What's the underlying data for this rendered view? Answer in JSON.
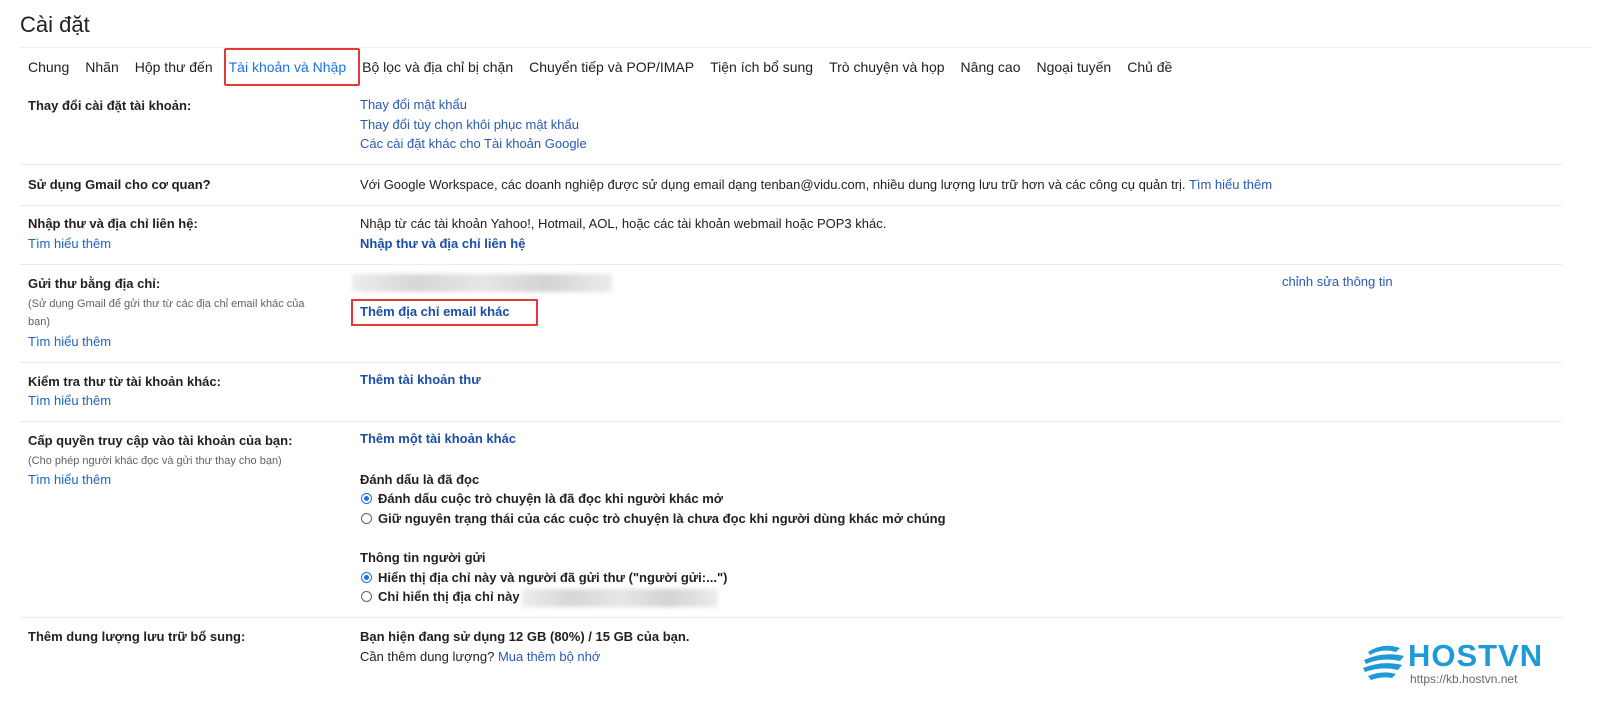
{
  "page_title": "Cài đặt",
  "tabs": [
    {
      "label": "Chung"
    },
    {
      "label": "Nhãn"
    },
    {
      "label": "Hộp thư đến"
    },
    {
      "label": "Tài khoản và Nhập",
      "active": true
    },
    {
      "label": "Bộ lọc và địa chỉ bị chặn"
    },
    {
      "label": "Chuyển tiếp và POP/IMAP"
    },
    {
      "label": "Tiện ích bổ sung"
    },
    {
      "label": "Trò chuyện và họp"
    },
    {
      "label": "Nâng cao"
    },
    {
      "label": "Ngoại tuyến"
    },
    {
      "label": "Chủ đề"
    }
  ],
  "rows": {
    "change_account": {
      "label": "Thay đổi cài đặt tài khoản:",
      "links": [
        "Thay đổi mật khẩu",
        "Thay đổi tùy chọn khôi phục mật khẩu",
        "Các cài đặt khác cho Tài khoản Google"
      ]
    },
    "workspace": {
      "label": "Sử dụng Gmail cho cơ quan?",
      "text": "Với Google Workspace, các doanh nghiệp được sử dụng email dạng tenban@vidu.com, nhiều dung lượng lưu trữ hơn và các công cụ quản trị.",
      "link": "Tìm hiểu thêm"
    },
    "import": {
      "label": "Nhập thư và địa chỉ liên hệ:",
      "learn_more": "Tìm hiểu thêm",
      "text": "Nhập từ các tài khoản Yahoo!, Hotmail, AOL, hoặc các tài khoản webmail hoặc POP3 khác.",
      "action": "Nhập thư và địa chỉ liên hệ"
    },
    "send_as": {
      "label": "Gửi thư bằng địa chỉ:",
      "sub1": "(Sử dụng Gmail để gửi thư từ các địa chỉ email khác của",
      "sub2": "bạn)",
      "learn_more": "Tìm hiểu thêm",
      "edit": "chỉnh sửa thông tin",
      "action": "Thêm địa chỉ email khác"
    },
    "check_mail": {
      "label": "Kiểm tra thư từ tài khoản khác:",
      "learn_more": "Tìm hiểu thêm",
      "action": "Thêm tài khoản thư"
    },
    "grant": {
      "label": "Cấp quyền truy cập vào tài khoản của bạn:",
      "sub": "(Cho phép người khác đọc và gửi thư thay cho bạn)",
      "learn_more": "Tìm hiểu thêm",
      "action": "Thêm một tài khoản khác",
      "mark_read_title": "Đánh dấu là đã đọc",
      "mark_read_opt1": "Đánh dấu cuộc trò chuyện là đã đọc khi người khác mở",
      "mark_read_opt2": "Giữ nguyên trạng thái của các cuộc trò chuyện là chưa đọc khi người dùng khác mở chúng",
      "sender_title": "Thông tin người gửi",
      "sender_opt1": "Hiển thị địa chỉ này và người đã gửi thư (\"người gửi:...\")",
      "sender_opt2": "Chỉ hiển thị địa chỉ này"
    },
    "storage": {
      "label": "Thêm dung lượng lưu trữ bổ sung:",
      "usage": "Bạn hiện đang sử dụng 12 GB (80%) / 15 GB của bạn.",
      "question": "Cần thêm dung lượng?",
      "link": "Mua thêm bộ nhớ"
    }
  },
  "brand": {
    "name": "HOSTVN",
    "url": "https://kb.hostvn.net"
  },
  "colors": {
    "accent": "#1a73e8",
    "link": "#2a58b8",
    "highlight": "#e53935",
    "brand": "#1f9ad9"
  }
}
